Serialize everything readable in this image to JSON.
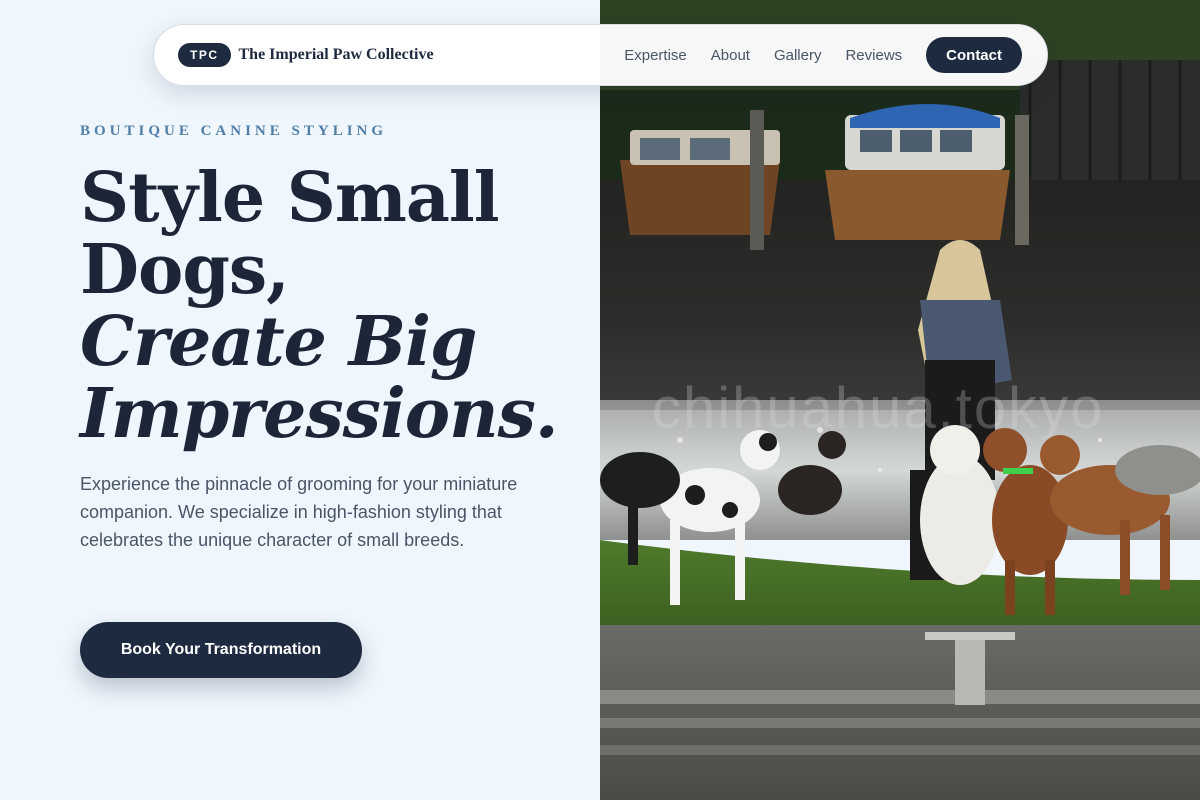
{
  "nav": {
    "badge": "TPC",
    "brand_name": "The Imperial Paw Collective",
    "links": [
      {
        "label": "Expertise"
      },
      {
        "label": "About"
      },
      {
        "label": "Gallery"
      },
      {
        "label": "Reviews"
      }
    ],
    "contact_label": "Contact"
  },
  "hero": {
    "eyebrow": "BOUTIQUE CANINE STYLING",
    "headline_line1": "Style Small",
    "headline_line2": "Dogs,",
    "headline_line3": "Create Big",
    "headline_line4": "Impressions.",
    "description": "Experience the pinnacle of grooming for your miniature companion. We specialize in high-fashion styling that celebrates the unique character of small breeds.",
    "cta_label": "Book Your Transformation"
  },
  "image": {
    "watermark": "chihuahua.tokyo"
  },
  "colors": {
    "background": "#eff6fd",
    "navy": "#1e2a3f",
    "accent_blue": "#4f7fa8",
    "body_text": "#4a5568"
  }
}
